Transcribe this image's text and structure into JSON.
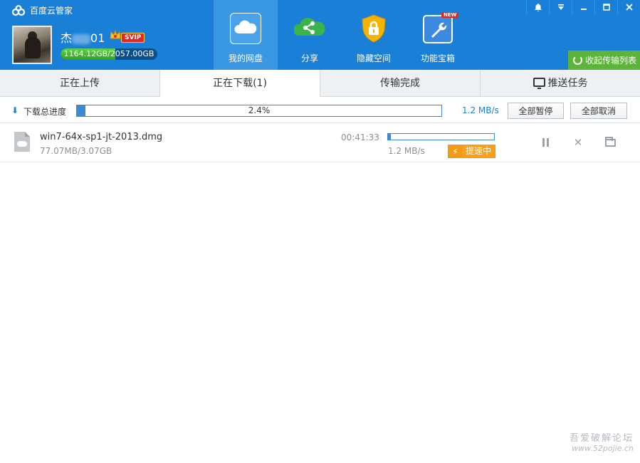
{
  "app": {
    "title": "百度云管家",
    "colors": {
      "header": "#1a7fd6",
      "accent": "#3d8ad0",
      "collapse_button": "#5db43a",
      "boost": "#f7a11a",
      "svip": "#e6261f"
    }
  },
  "user": {
    "name_prefix": "杰",
    "name_suffix": "01",
    "badge": "SVIP",
    "quota_text": "1164.12GB/2057.00GB",
    "quota_fraction": 0.566
  },
  "nav": {
    "items": [
      {
        "label": "我的网盘",
        "icon": "cloud-icon",
        "active": true
      },
      {
        "label": "分享",
        "icon": "share-icon",
        "active": false
      },
      {
        "label": "隐藏空间",
        "icon": "lock-shield-icon",
        "active": false
      },
      {
        "label": "功能宝箱",
        "icon": "wrench-icon",
        "active": false
      }
    ],
    "new_badge": "NEW"
  },
  "window_controls": [
    "bell-icon",
    "dropdown-icon",
    "minimize-icon",
    "maximize-icon",
    "close-icon"
  ],
  "collapse_label": "收起传输列表",
  "tabs": [
    {
      "label": "正在上传",
      "active": false
    },
    {
      "label": "正在下载(1)",
      "active": true
    },
    {
      "label": "传输完成",
      "active": false
    },
    {
      "label": "推送任务",
      "active": false,
      "icon": "monitor-icon"
    }
  ],
  "progress": {
    "label": "下载总进度",
    "percent_text": "2.4%",
    "fraction": 0.024,
    "speed": "1.2 MB/s",
    "pause_all": "全部暂停",
    "cancel_all": "全部取消"
  },
  "tasks": [
    {
      "name": "win7-64x-sp1-jt-2013.dmg",
      "size": "77.07MB/3.07GB",
      "eta": "00:41:33",
      "fraction": 0.024,
      "speed": "1.2 MB/s",
      "boost_label": "提速中"
    }
  ],
  "watermark": {
    "line1": "吾爱破解论坛",
    "line2": "www.52pojie.cn"
  }
}
